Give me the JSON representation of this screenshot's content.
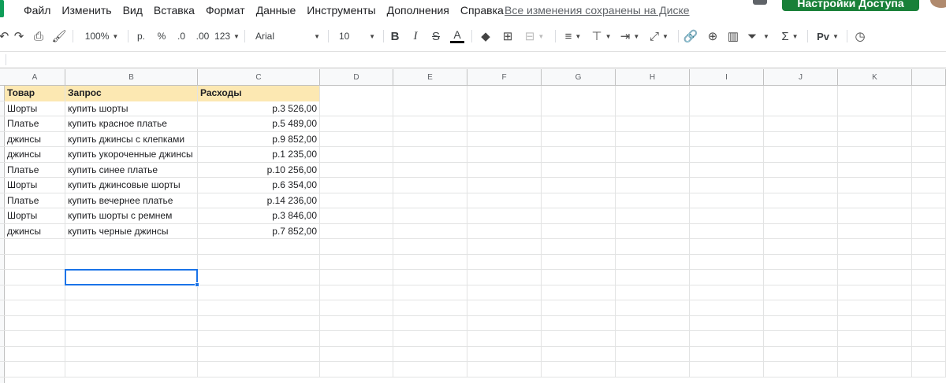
{
  "menu": {
    "items": [
      "Файл",
      "Изменить",
      "Вид",
      "Вставка",
      "Формат",
      "Данные",
      "Инструменты",
      "Дополнения",
      "Справка"
    ],
    "save_status": "Все изменения сохранены на Диске",
    "share_label": "Настройки Доступа"
  },
  "toolbar": {
    "zoom": "100%",
    "currency": "р.",
    "percent": "%",
    "dec_less": ".0",
    "dec_more": ".00",
    "format_more": "123",
    "font": "Arial",
    "font_size": "10",
    "bold": "B",
    "italic": "I",
    "strike": "S",
    "text_color": "A",
    "sigma": "Σ",
    "script_label": "Pv"
  },
  "sheet": {
    "columns": [
      "A",
      "B",
      "C",
      "D",
      "E",
      "F",
      "G",
      "H",
      "I",
      "J",
      "K"
    ],
    "header": [
      "Товар",
      "Запрос",
      "Расходы"
    ],
    "rows": [
      [
        "Шорты",
        "купить шорты",
        "р.3 526,00"
      ],
      [
        "Платье",
        "купить красное платье",
        "р.5 489,00"
      ],
      [
        "джинсы",
        "купить джинсы с клепками",
        "р.9 852,00"
      ],
      [
        "джинсы",
        "купить укороченные джинсы",
        "р.1 235,00"
      ],
      [
        "Платье",
        "купить синее платье",
        "р.10 256,00"
      ],
      [
        "Шорты",
        "купить джинсовые шорты",
        "р.6 354,00"
      ],
      [
        "Платье",
        "купить вечернее платье",
        "р.14 236,00"
      ],
      [
        "Шорты",
        "купить шорты с ремнем",
        "р.3 846,00"
      ],
      [
        "джинсы",
        "купить черные джинсы",
        "р.7 852,00"
      ]
    ]
  },
  "colors": {
    "header_fill": "#fce8b2",
    "selection": "#1a73e8",
    "share_button": "#188038",
    "brand": "#0f9d58"
  }
}
